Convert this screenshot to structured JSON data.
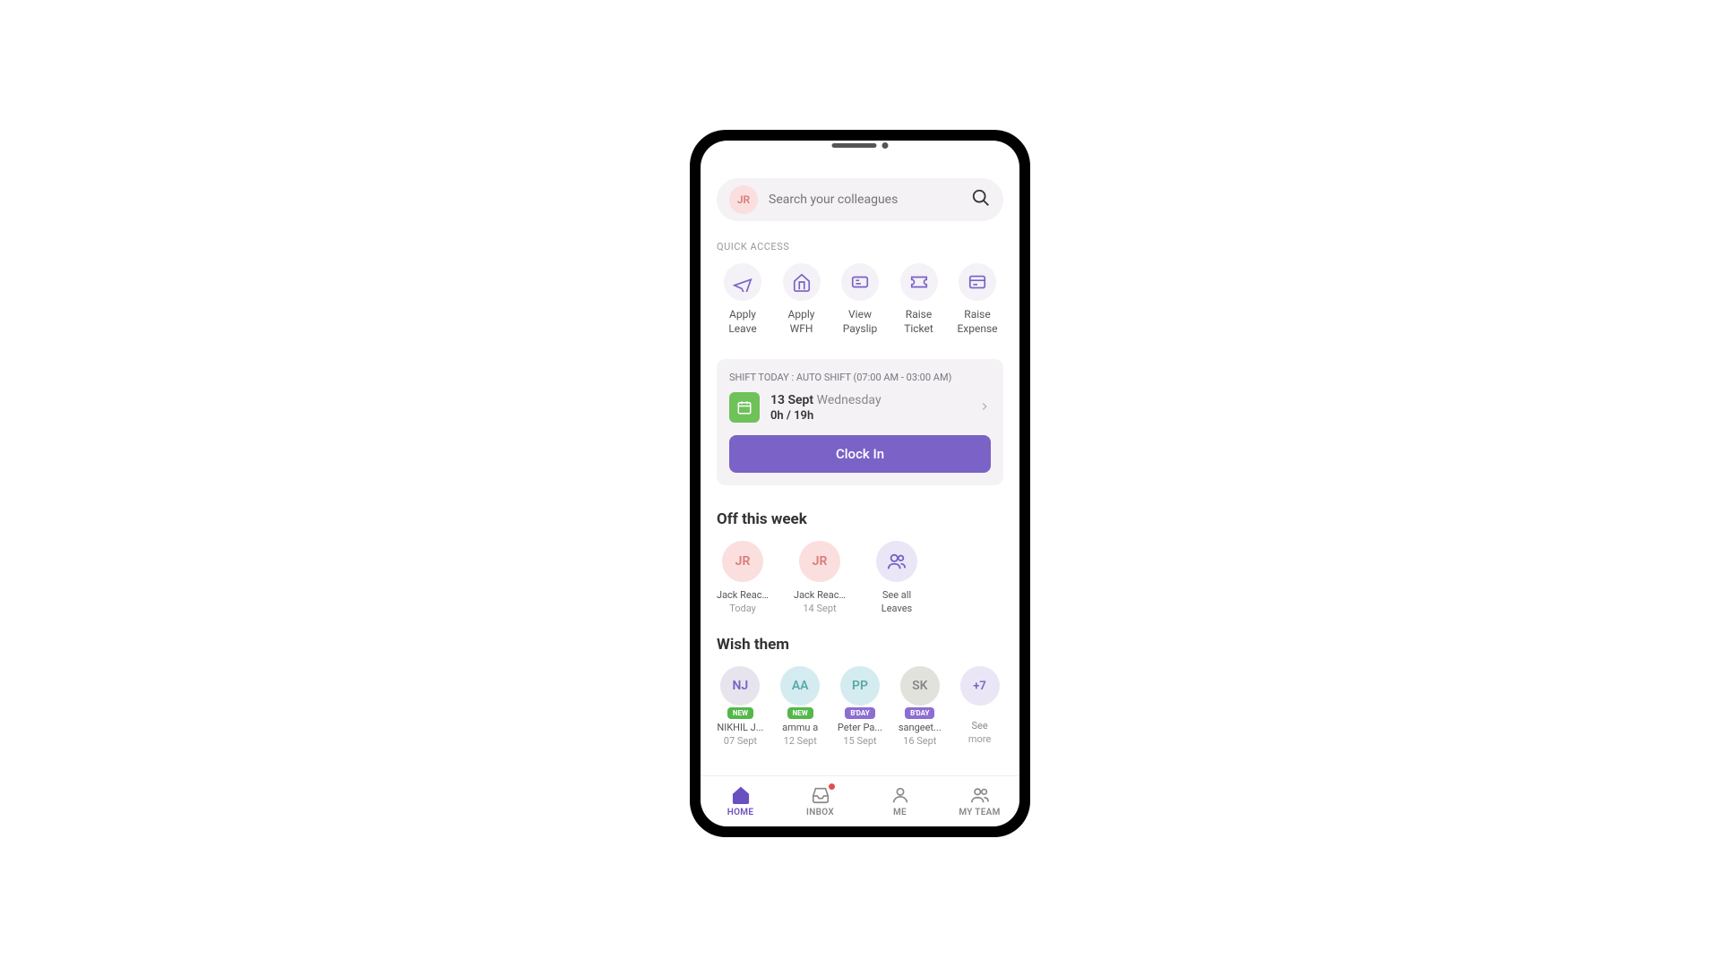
{
  "header": {
    "avatar_initials": "JR",
    "search_placeholder": "Search your colleagues"
  },
  "quick_access": {
    "label": "QUICK ACCESS",
    "items": [
      {
        "line1": "Apply",
        "line2": "Leave"
      },
      {
        "line1": "Apply",
        "line2": "WFH"
      },
      {
        "line1": "View",
        "line2": "Payslip"
      },
      {
        "line1": "Raise",
        "line2": "Ticket"
      },
      {
        "line1": "Raise",
        "line2": "Expense"
      }
    ]
  },
  "shift": {
    "label_prefix": "SHIFT TODAY :",
    "label_value": "AUTO SHIFT (07:00 AM - 03:00 AM)",
    "date": "13 Sept",
    "day": "Wednesday",
    "hours": "0h / 19h",
    "button": "Clock In"
  },
  "off_week": {
    "heading": "Off this week",
    "items": [
      {
        "initials": "JR",
        "name": "Jack Reac...",
        "sub": "Today"
      },
      {
        "initials": "JR",
        "name": "Jack Reac...",
        "sub": "14 Sept"
      }
    ],
    "see_all_line1": "See all",
    "see_all_line2": "Leaves"
  },
  "wish": {
    "heading": "Wish them",
    "items": [
      {
        "initials": "NJ",
        "badge": "NEW",
        "badge_type": "new",
        "name": "NIKHIL J...",
        "date": "07 Sept",
        "circle_class": "wc-nj"
      },
      {
        "initials": "AA",
        "badge": "NEW",
        "badge_type": "new",
        "name": "ammu a",
        "date": "12 Sept",
        "circle_class": "wc-aa"
      },
      {
        "initials": "PP",
        "badge": "B'DAY",
        "badge_type": "bday",
        "name": "Peter Pa...",
        "date": "15 Sept",
        "circle_class": "wc-pp"
      },
      {
        "initials": "SK",
        "badge": "B'DAY",
        "badge_type": "bday",
        "name": "sangeet...",
        "date": "16 Sept",
        "circle_class": "wc-sk"
      }
    ],
    "more_count": "+7",
    "more_line1": "See",
    "more_line2": "more"
  },
  "nav": {
    "home": "HOME",
    "inbox": "INBOX",
    "me": "ME",
    "team": "MY TEAM"
  }
}
